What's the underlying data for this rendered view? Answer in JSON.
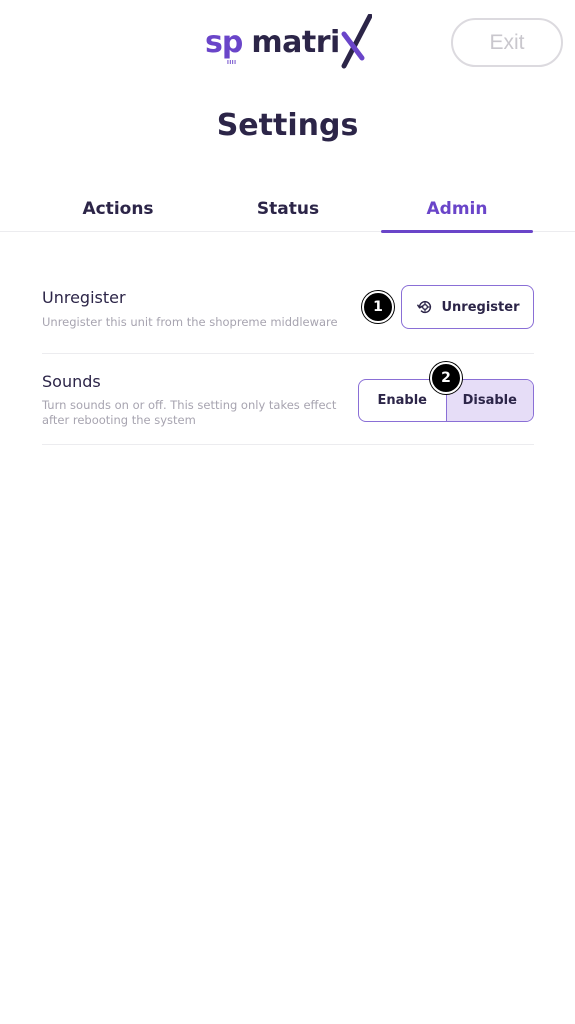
{
  "header": {
    "logo_sp": "sp",
    "logo_sp_small": "IIII",
    "logo_matrix": "matri",
    "logo_x": "X",
    "exit_label": "Exit"
  },
  "page_title": "Settings",
  "tabs": [
    {
      "label": "Actions",
      "active": false
    },
    {
      "label": "Status",
      "active": false
    },
    {
      "label": "Admin",
      "active": true
    }
  ],
  "settings": {
    "unregister": {
      "title": "Unregister",
      "description": "Unregister this unit from the shopreme middleware",
      "button_label": "Unregister",
      "button_icon": "unregister-icon"
    },
    "sounds": {
      "title": "Sounds",
      "description": "Turn sounds on or off. This setting only takes effect after rebooting the system",
      "options": [
        {
          "label": "Enable",
          "selected": false
        },
        {
          "label": "Disable",
          "selected": true
        }
      ]
    }
  },
  "annotations": [
    {
      "label": "1"
    },
    {
      "label": "2"
    }
  ],
  "colors": {
    "accent": "#6a45c9",
    "text_dark": "#2c2548",
    "muted": "#a7a4b0",
    "selected_bg": "#e6ddf7"
  }
}
